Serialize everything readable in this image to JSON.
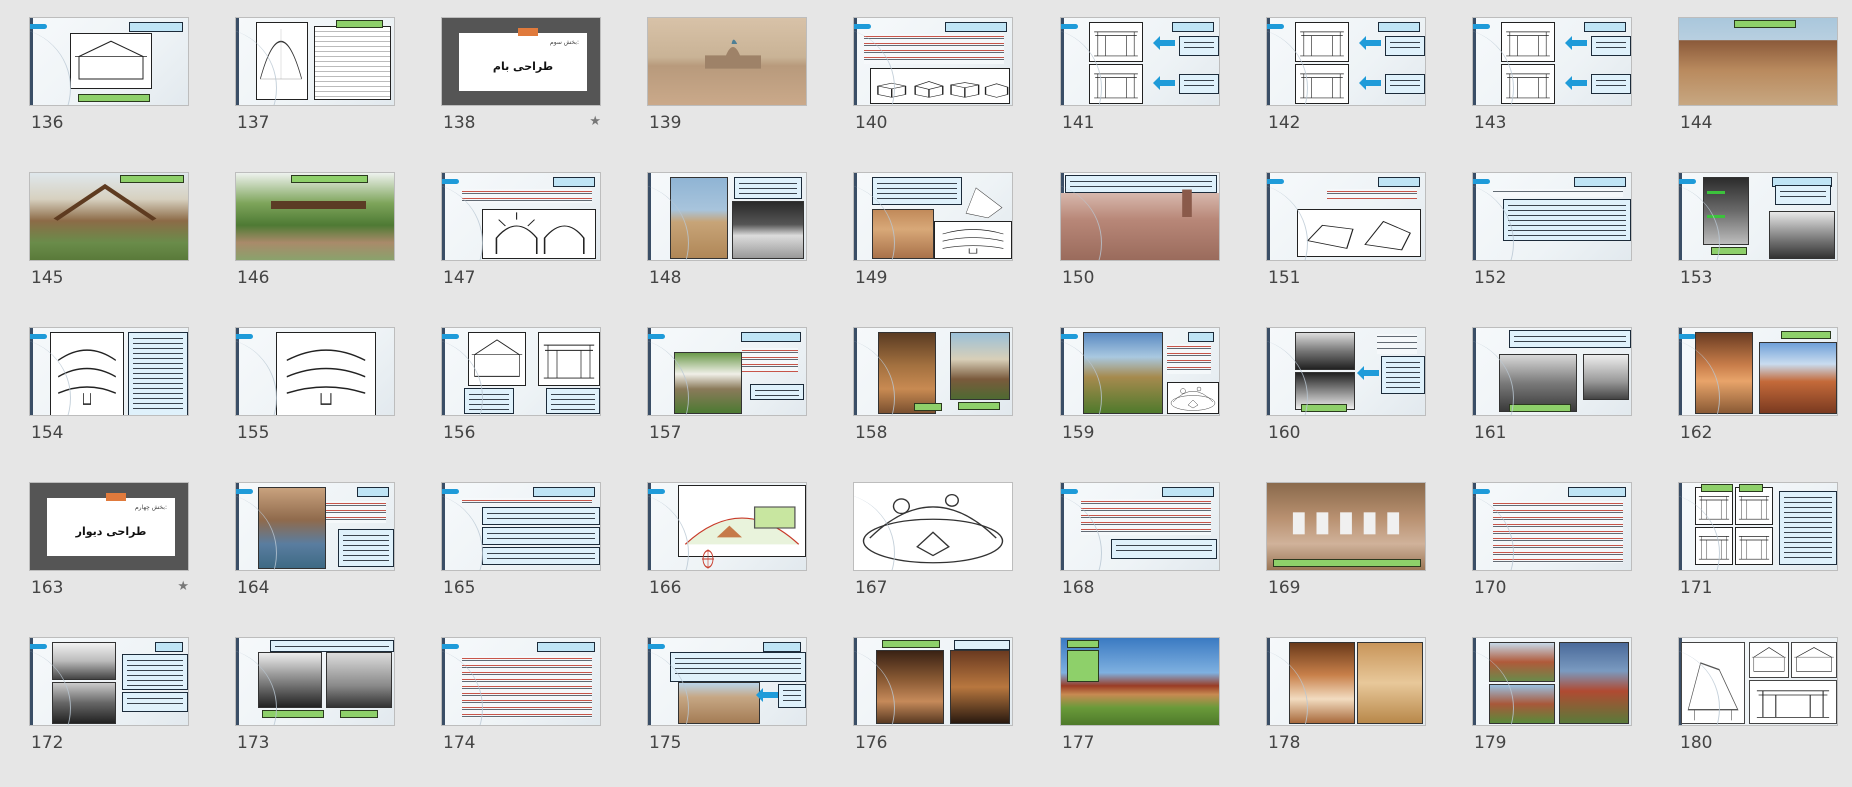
{
  "view": "slide-sorter",
  "colors": {
    "background": "#e6e6e6",
    "accent": "#1f9bd9",
    "title_box": "#bfe4f5",
    "label_green": "#8ed06a",
    "section_bg": "#555555",
    "section_tab": "#e07a3c"
  },
  "slides": [
    {
      "number": "136",
      "kind": "content",
      "variant": "roof-diagram"
    },
    {
      "number": "137",
      "kind": "content",
      "variant": "chart-table"
    },
    {
      "number": "138",
      "kind": "section",
      "subtitle": "بخش سوم:",
      "title": "طراحی بام",
      "star": "★"
    },
    {
      "number": "139",
      "kind": "photo",
      "variant": "desert-mosque"
    },
    {
      "number": "140",
      "kind": "content",
      "variant": "text-cubes"
    },
    {
      "number": "141",
      "kind": "content",
      "variant": "two-sketches-arrows"
    },
    {
      "number": "142",
      "kind": "content",
      "variant": "two-sketches-arrows"
    },
    {
      "number": "143",
      "kind": "content",
      "variant": "two-sketches-arrows"
    },
    {
      "number": "144",
      "kind": "photo",
      "variant": "mud-house"
    },
    {
      "number": "145",
      "kind": "photo",
      "variant": "bamboo-hut"
    },
    {
      "number": "146",
      "kind": "photo",
      "variant": "green-shelter"
    },
    {
      "number": "147",
      "kind": "content",
      "variant": "arch-sketch"
    },
    {
      "number": "148",
      "kind": "content",
      "variant": "domes-photos"
    },
    {
      "number": "149",
      "kind": "content",
      "variant": "domes-sketch"
    },
    {
      "number": "150",
      "kind": "content",
      "variant": "dome-photo"
    },
    {
      "number": "151",
      "kind": "content",
      "variant": "roof-sketches"
    },
    {
      "number": "152",
      "kind": "content",
      "variant": "text-only"
    },
    {
      "number": "153",
      "kind": "content",
      "variant": "bw-photos-arrows"
    },
    {
      "number": "154",
      "kind": "content",
      "variant": "sketch-textbox"
    },
    {
      "number": "155",
      "kind": "content",
      "variant": "centered-sketch"
    },
    {
      "number": "156",
      "kind": "content",
      "variant": "two-sketches-text"
    },
    {
      "number": "157",
      "kind": "content",
      "variant": "house-photo"
    },
    {
      "number": "158",
      "kind": "content",
      "variant": "veranda-photos"
    },
    {
      "number": "159",
      "kind": "content",
      "variant": "hut-photo"
    },
    {
      "number": "160",
      "kind": "content",
      "variant": "bw-photos-text"
    },
    {
      "number": "161",
      "kind": "content",
      "variant": "photos-text"
    },
    {
      "number": "162",
      "kind": "content",
      "variant": "render-photos"
    },
    {
      "number": "163",
      "kind": "section",
      "subtitle": "بخش چهارم:",
      "title": "طراحی دیوار",
      "star": "★"
    },
    {
      "number": "164",
      "kind": "content",
      "variant": "iwan-photo"
    },
    {
      "number": "165",
      "kind": "content",
      "variant": "text-boxes"
    },
    {
      "number": "166",
      "kind": "content",
      "variant": "sun-diagram"
    },
    {
      "number": "167",
      "kind": "content",
      "variant": "sun-sketch"
    },
    {
      "number": "168",
      "kind": "content",
      "variant": "text-box-bottom"
    },
    {
      "number": "169",
      "kind": "photo",
      "variant": "courtyard"
    },
    {
      "number": "170",
      "kind": "content",
      "variant": "red-text"
    },
    {
      "number": "171",
      "kind": "content",
      "variant": "wall-sketches"
    },
    {
      "number": "172",
      "kind": "content",
      "variant": "bw-photos"
    },
    {
      "number": "173",
      "kind": "content",
      "variant": "bw-buildings"
    },
    {
      "number": "174",
      "kind": "content",
      "variant": "red-text"
    },
    {
      "number": "175",
      "kind": "content",
      "variant": "windcatcher"
    },
    {
      "number": "176",
      "kind": "content",
      "variant": "interior-photos"
    },
    {
      "number": "177",
      "kind": "photo",
      "variant": "stilt-house"
    },
    {
      "number": "178",
      "kind": "content",
      "variant": "wood-interior"
    },
    {
      "number": "179",
      "kind": "content",
      "variant": "house-photos"
    },
    {
      "number": "180",
      "kind": "content",
      "variant": "pencil-sketches"
    }
  ]
}
